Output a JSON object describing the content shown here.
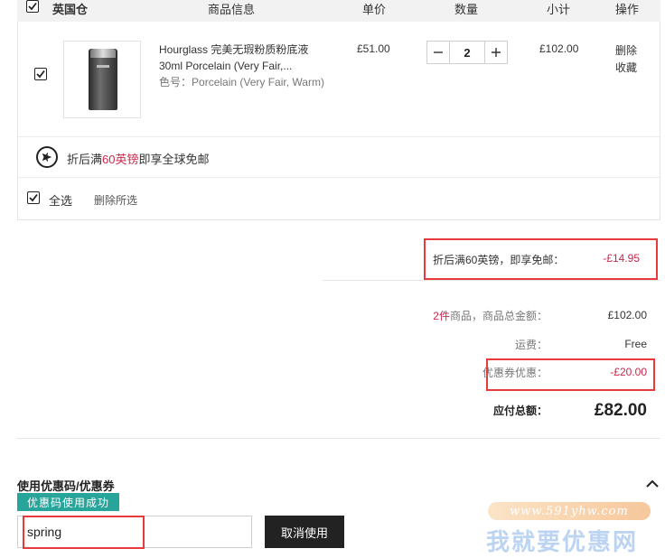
{
  "header": {
    "warehouse": "英国仓",
    "col_product": "商品信息",
    "col_unit_price": "单价",
    "col_quantity": "数量",
    "col_subtotal": "小计",
    "col_actions": "操作"
  },
  "item": {
    "name": "Hourglass 完美无瑕粉质粉底液30ml Porcelain (Very Fair,...",
    "color_label": "色号：",
    "color_value": "Porcelain (Very Fair, Warm)",
    "unit_price": "£51.00",
    "quantity": "2",
    "subtotal": "£102.00",
    "action_delete": "删除",
    "action_favorite": "收藏",
    "checked": true,
    "thumb_icon": "foundation-tube-image"
  },
  "shipping": {
    "icon": "airplane-icon",
    "text_before": "折后满",
    "text_highlight": "60英镑",
    "text_after": "即享全球免邮"
  },
  "footer_actions": {
    "select_all": "全选",
    "delete_selected": "删除所选"
  },
  "summary": {
    "free_ship_label": "折后满60英镑，即享免邮：",
    "free_ship_value": "-£14.95",
    "item_count": "2件",
    "items_total_label": "商品，商品总金额：",
    "items_total_value": "£102.00",
    "shipping_label": "运费：",
    "shipping_value": "Free",
    "coupon_label": "优惠券优惠：",
    "coupon_value": "-£20.00",
    "payable_label": "应付总额：",
    "payable_value": "£82.00"
  },
  "coupon": {
    "title": "使用优惠码/优惠券",
    "success_badge": "优惠码使用成功",
    "code_value": "spring",
    "cancel_label": "取消使用",
    "collapse_icon": "chevron-up-icon"
  },
  "watermark": {
    "url": "www.591yhw.com",
    "name": "我就要优惠网"
  },
  "colors": {
    "accent_red": "#c8284b",
    "highlight_border": "#e83a3a",
    "success_green": "#27a59a",
    "button_dark": "#222222"
  }
}
